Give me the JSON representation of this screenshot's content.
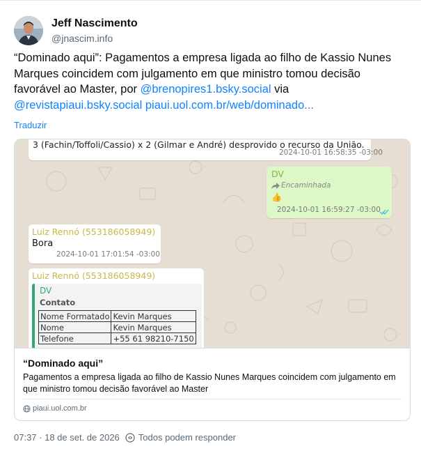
{
  "author": {
    "display_name": "Jeff Nascimento",
    "handle": "@jnascim.info"
  },
  "post": {
    "text_main": "“Dominado aqui”: Pagamentos a empresa ligada ao filho de Kassio Nunes Marques coincidem com julgamento em que ministro tomou decisão favorável ao Master, por ",
    "mention_1": "@brenopires1.bsky.social",
    "text_via": " via ",
    "mention_2": "@revistapiaui.bsky.social",
    "link": "piaui.uol.com.br/web/dominado...",
    "translate_label": "Traduzir"
  },
  "embed": {
    "image": {
      "msg1_text": "3 (Fachin/Toffoli/Cassio) x 2 (Gilmar e André) desprovido o recurso da União.",
      "msg1_time": "2024-10-01 16:58:35 -03:00",
      "msg2_sender": "DV",
      "msg2_forwarded": "Encaminhada",
      "msg2_emoji": "👍",
      "msg2_time": "2024-10-01 16:59:27 -03:00",
      "msg3_sender": "Luiz Rennó (553186058949)",
      "msg3_text": "Bora",
      "msg3_time": "2024-10-01 17:01:54 -03:00",
      "msg4_sender": "Luiz Rennó (553186058949)",
      "quote_name": "DV",
      "quote_title": "Contato",
      "contact_rows": [
        [
          "Nome Formatado",
          "Kevin Marques"
        ],
        [
          "Nome",
          "Kevin Marques"
        ],
        [
          "Telefone",
          "+55 61 98210-7150"
        ]
      ]
    },
    "title": "“Dominado aqui”",
    "description": "Pagamentos a empresa ligada ao filho de Kassio Nunes Marques coincidem com julgamento em que ministro tomou decisão favorável ao Master",
    "domain": "piaui.uol.com.br"
  },
  "footer": {
    "timestamp": "07:37 · 18 de set. de 2026",
    "reply_setting": "Todos podem responder"
  },
  "colors": {
    "link": "#1083fe",
    "muted": "#5b6975",
    "whatsapp_bg": "#e7ded3",
    "outgoing_bubble": "#dcf8c6"
  }
}
